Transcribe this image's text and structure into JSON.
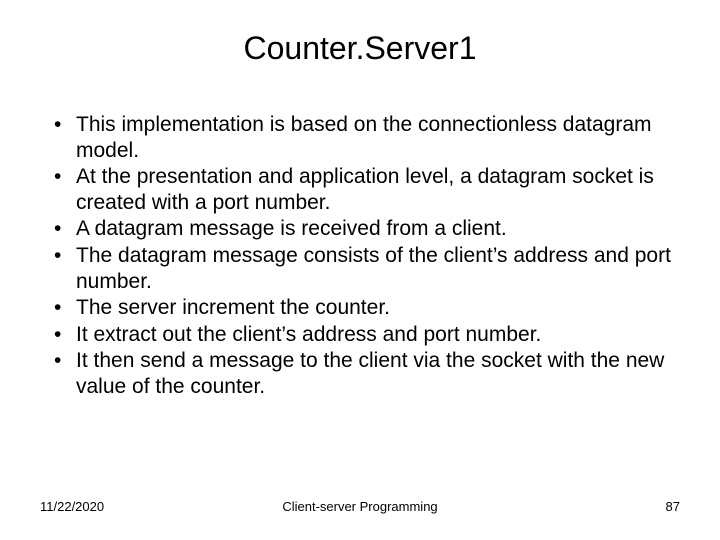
{
  "title": "Counter.Server1",
  "bullets": [
    "This implementation is based on the connectionless datagram model.",
    "At the presentation and application level, a datagram socket is created with a port number.",
    "A datagram message is received from a client.",
    "The datagram message consists of the client’s address and port number.",
    "The server increment the counter.",
    "It extract out the client’s address and port number.",
    "It then send a message to the client via the socket with the new value of the counter."
  ],
  "footer": {
    "date": "11/22/2020",
    "center": "Client-server Programming",
    "page": "87"
  }
}
